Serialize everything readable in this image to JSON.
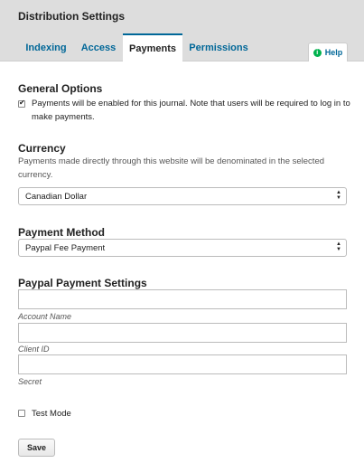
{
  "header": {
    "title": "Distribution Settings",
    "tabs": [
      {
        "label": "Indexing"
      },
      {
        "label": "Access"
      },
      {
        "label": "Payments"
      },
      {
        "label": "Permissions"
      }
    ],
    "help_label": "Help",
    "help_icon": "info-icon"
  },
  "general": {
    "title": "General Options",
    "payments_checkbox_label": "Payments will be enabled for this journal. Note that users will be required to log in to make payments.",
    "payments_enabled": true
  },
  "currency": {
    "title": "Currency",
    "description": "Payments made directly through this website will be denominated in the selected currency.",
    "selected": "Canadian Dollar"
  },
  "payment_method": {
    "title": "Payment Method",
    "selected": "Paypal Fee Payment"
  },
  "paypal": {
    "title": "Paypal Payment Settings",
    "account_name_label": "Account Name",
    "account_name_value": "",
    "client_id_label": "Client ID",
    "client_id_value": "",
    "secret_label": "Secret",
    "secret_value": "",
    "test_mode_label": "Test Mode",
    "test_mode": false
  },
  "actions": {
    "save_label": "Save"
  },
  "colors": {
    "accent": "#006798",
    "help_icon": "#00b24e",
    "header_bg": "#dddddd"
  }
}
